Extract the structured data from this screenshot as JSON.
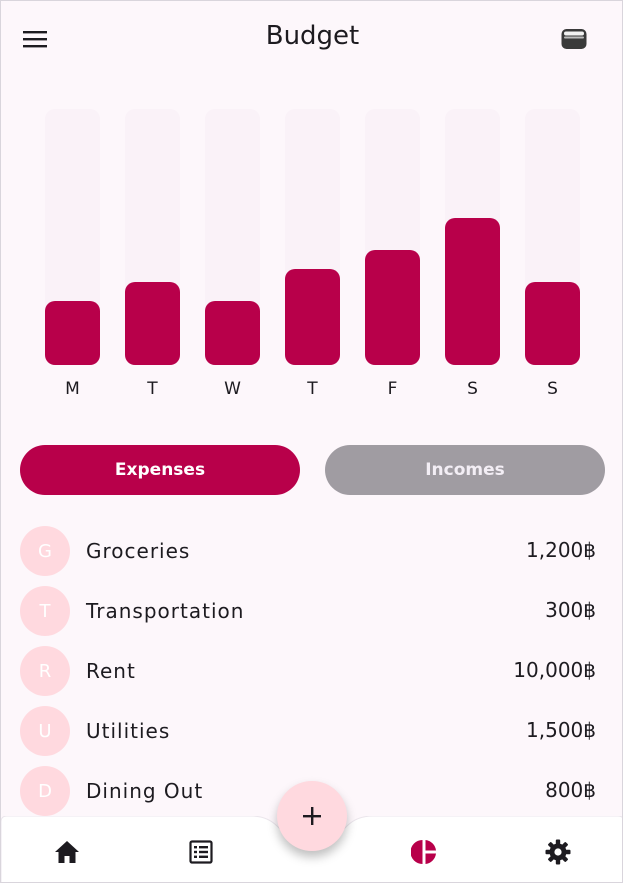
{
  "app": {
    "title": "Budget"
  },
  "icons": {
    "menu": "menu-icon",
    "wallet": "wallet-icon",
    "home": "home-icon",
    "list": "list-icon",
    "chart": "pie-chart-icon",
    "settings": "gear-icon",
    "add": "plus-icon"
  },
  "colors": {
    "accent": "#b8004a",
    "accent_light": "#ffd9df",
    "inactive": "#a09ca2",
    "background": "#fdf7fb"
  },
  "chart_data": {
    "type": "bar",
    "categories": [
      "M",
      "T",
      "W",
      "T",
      "F",
      "S",
      "S"
    ],
    "values": [
      25,
      32.5,
      25,
      37.5,
      45,
      57.5,
      32.5
    ],
    "ylim": [
      0,
      100
    ]
  },
  "toggle": {
    "expenses_label": "Expenses",
    "incomes_label": "Incomes",
    "selected": "Expenses"
  },
  "categories": [
    {
      "initial": "G",
      "name": "Groceries",
      "amount": "1,200฿"
    },
    {
      "initial": "T",
      "name": "Transportation",
      "amount": "300฿"
    },
    {
      "initial": "R",
      "name": "Rent",
      "amount": "10,000฿"
    },
    {
      "initial": "U",
      "name": "Utilities",
      "amount": "1,500฿"
    },
    {
      "initial": "D",
      "name": "Dining Out",
      "amount": "800฿"
    }
  ],
  "bottom_nav": {
    "active": "pie-chart-icon"
  }
}
